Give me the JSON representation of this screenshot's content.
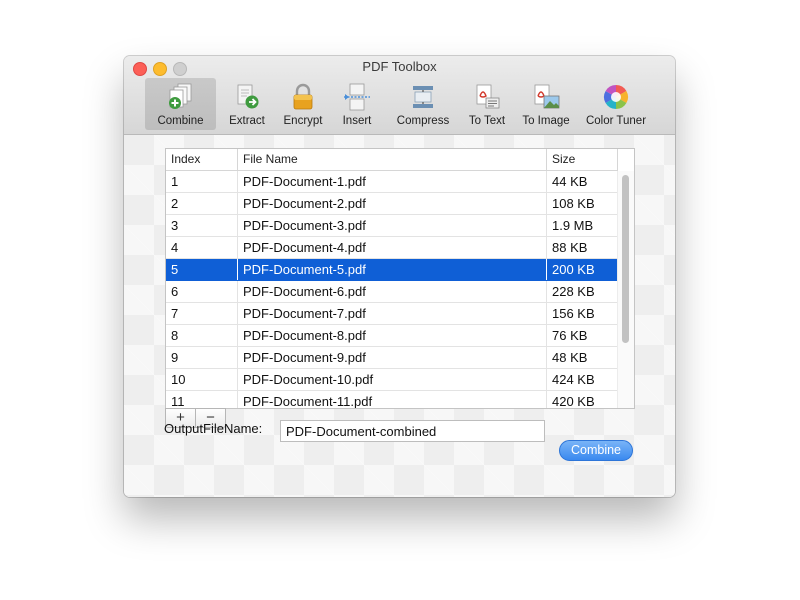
{
  "window": {
    "title": "PDF Toolbox"
  },
  "toolbar": {
    "items": [
      {
        "label": "Combine",
        "icon": "combine-icon",
        "selected": true
      },
      {
        "label": "Extract",
        "icon": "extract-icon",
        "selected": false
      },
      {
        "label": "Encrypt",
        "icon": "lock-icon",
        "selected": false
      },
      {
        "label": "Insert",
        "icon": "insert-icon",
        "selected": false
      },
      {
        "label": "Compress",
        "icon": "compress-icon",
        "selected": false
      },
      {
        "label": "To Text",
        "icon": "to-text-icon",
        "selected": false
      },
      {
        "label": "To Image",
        "icon": "to-image-icon",
        "selected": false
      },
      {
        "label": "Color Tuner",
        "icon": "color-wheel-icon",
        "selected": false
      }
    ]
  },
  "table": {
    "columns": [
      "Index",
      "File Name",
      "Size"
    ],
    "rows": [
      {
        "index": "1",
        "name": "PDF-Document-1.pdf",
        "size": "44 KB"
      },
      {
        "index": "2",
        "name": "PDF-Document-2.pdf",
        "size": "108 KB"
      },
      {
        "index": "3",
        "name": "PDF-Document-3.pdf",
        "size": "1.9 MB"
      },
      {
        "index": "4",
        "name": "PDF-Document-4.pdf",
        "size": "88 KB"
      },
      {
        "index": "5",
        "name": "PDF-Document-5.pdf",
        "size": "200 KB"
      },
      {
        "index": "6",
        "name": "PDF-Document-6.pdf",
        "size": "228 KB"
      },
      {
        "index": "7",
        "name": "PDF-Document-7.pdf",
        "size": "156 KB"
      },
      {
        "index": "8",
        "name": "PDF-Document-8.pdf",
        "size": "76 KB"
      },
      {
        "index": "9",
        "name": "PDF-Document-9.pdf",
        "size": "48 KB"
      },
      {
        "index": "10",
        "name": "PDF-Document-10.pdf",
        "size": "424 KB"
      },
      {
        "index": "11",
        "name": "PDF-Document-11.pdf",
        "size": "420 KB"
      }
    ],
    "selected_row": "5"
  },
  "list_buttons": {
    "add": "+",
    "remove": "−"
  },
  "output": {
    "label": "OutputFileName:",
    "value": "PDF-Document-combined"
  },
  "combine_button": "Combine",
  "colors": {
    "selection": "#0f5fd6",
    "primary_button": "#3a89ef",
    "close": "#fc5f57",
    "minimize": "#fdbc2e"
  }
}
